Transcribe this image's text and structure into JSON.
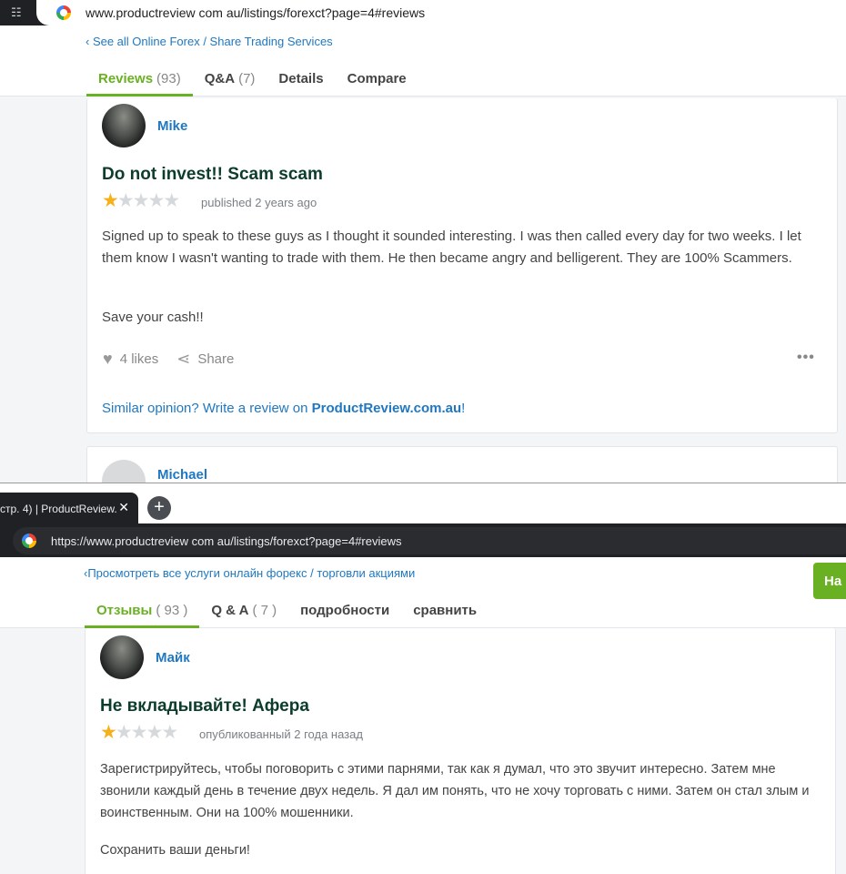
{
  "top": {
    "address_url": "www.productreview com au/listings/forexct?page=4#reviews",
    "breadcrumb": "‹ See all Online Forex / Share Trading Services",
    "tabs": [
      {
        "label": "Reviews",
        "count": "(93)"
      },
      {
        "label": "Q&A",
        "count": "(7)"
      },
      {
        "label": "Details",
        "count": ""
      },
      {
        "label": "Compare",
        "count": ""
      }
    ],
    "review": {
      "author": "Mike",
      "title": "Do not invest!! Scam scam",
      "rating": 1,
      "rating_max": 5,
      "published": "published 2 years ago",
      "body_1": "Signed up to speak to these guys as I thought it sounded interesting. I was then called every day for two weeks. I let them know I wasn't wanting to trade with them. He then became angry and belligerent. They are 100% Scammers.",
      "body_2": "Save your cash!!",
      "likes": "4 likes",
      "share": "Share",
      "more": "•••",
      "similar_prefix": "Similar opinion? Write a review on ",
      "similar_link": "ProductReview.com.au",
      "similar_suffix": "!"
    },
    "next_review_author": "Michael"
  },
  "bottom": {
    "tab_title": "стр. 4) | ProductReview.",
    "tab_close": "✕",
    "new_tab": "+",
    "address_url": "https://www.productreview com au/listings/forexct?page=4#reviews",
    "breadcrumb": "‹Просмотреть все услуги онлайн форекс / торговли акциями",
    "tabs": [
      {
        "label": "Отзывы",
        "count": "( 93 )"
      },
      {
        "label": "Q & A",
        "count": "( 7 )"
      },
      {
        "label": "подробности",
        "count": ""
      },
      {
        "label": "сравнить",
        "count": ""
      }
    ],
    "green_button": "На",
    "review": {
      "author": "Майк",
      "title": "Не вкладывайте! Афера",
      "rating": 1,
      "rating_max": 5,
      "published": "опубликованный 2 года назад",
      "body_1": "Зарегистрируйтесь, чтобы поговорить с этими парнями, так как я думал, что это звучит интересно. Затем мне звонили каждый день в течение двух недель. Я дал им понять, что не хочу торговать с ними. Затем он стал злым и воинственным. Они на 100% мошенники.",
      "body_2": "Сохранить ваши деньги!"
    }
  },
  "colors": {
    "accent_green": "#6ab023",
    "link_blue": "#1f78c1",
    "title_dark_green": "#0b3d2a",
    "star_gold": "#f5b01a"
  },
  "icons": [
    "apps-grid-icon",
    "google-icon",
    "heart-icon",
    "share-icon",
    "more-dots-icon",
    "close-icon",
    "plus-icon"
  ]
}
